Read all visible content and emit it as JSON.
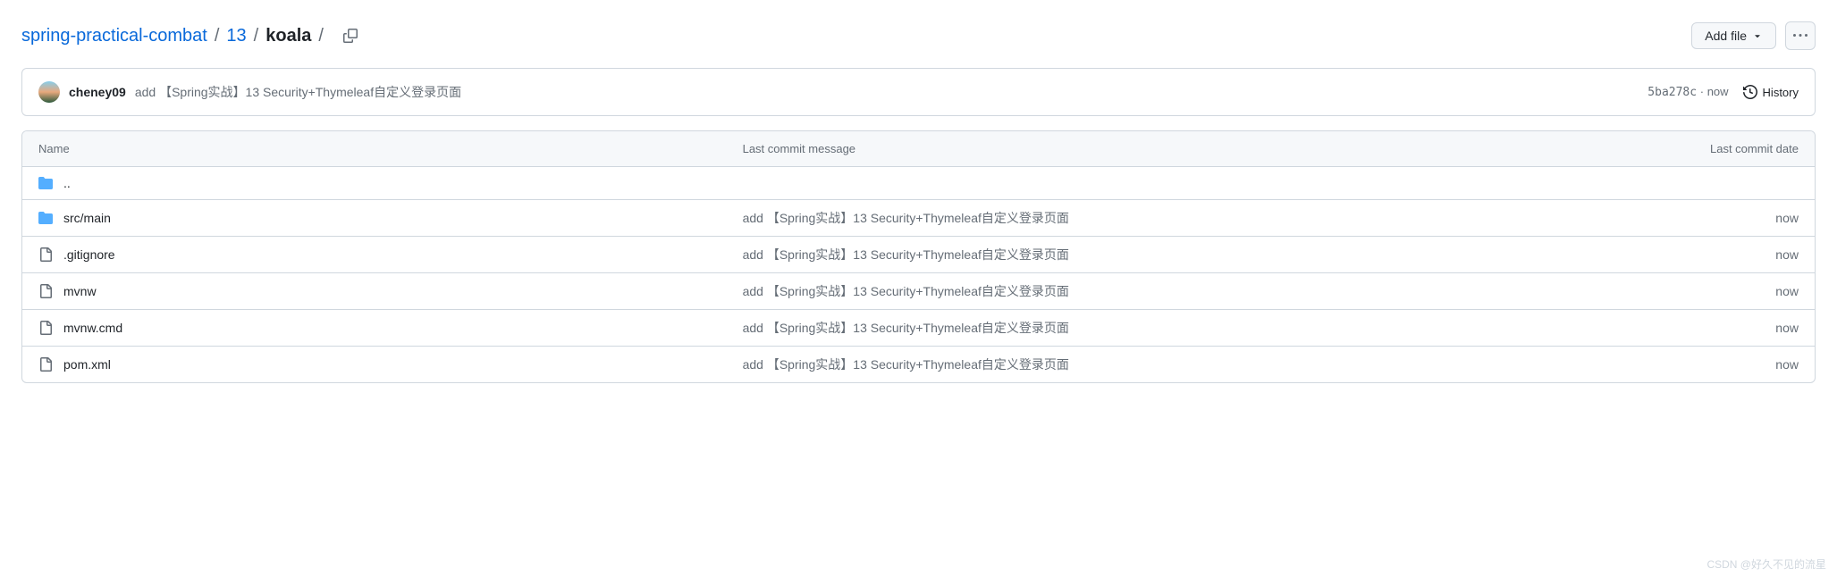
{
  "breadcrumb": {
    "root": "spring-practical-combat",
    "mid": "13",
    "current": "koala"
  },
  "actions": {
    "add_file": "Add file"
  },
  "commit": {
    "author": "cheney09",
    "message": "add 【Spring实战】13 Security+Thymeleaf自定义登录页面",
    "hash": "5ba278c",
    "sep": "·",
    "time": "now",
    "history": "History"
  },
  "columns": {
    "name": "Name",
    "message": "Last commit message",
    "date": "Last commit date"
  },
  "files": [
    {
      "type": "up",
      "name": ".."
    },
    {
      "type": "dir",
      "name": "src/main",
      "msg": "add 【Spring实战】13 Security+Thymeleaf自定义登录页面",
      "time": "now"
    },
    {
      "type": "file",
      "name": ".gitignore",
      "msg": "add 【Spring实战】13 Security+Thymeleaf自定义登录页面",
      "time": "now"
    },
    {
      "type": "file",
      "name": "mvnw",
      "msg": "add 【Spring实战】13 Security+Thymeleaf自定义登录页面",
      "time": "now"
    },
    {
      "type": "file",
      "name": "mvnw.cmd",
      "msg": "add 【Spring实战】13 Security+Thymeleaf自定义登录页面",
      "time": "now"
    },
    {
      "type": "file",
      "name": "pom.xml",
      "msg": "add 【Spring实战】13 Security+Thymeleaf自定义登录页面",
      "time": "now"
    }
  ],
  "watermark": "CSDN @好久不见的流星"
}
